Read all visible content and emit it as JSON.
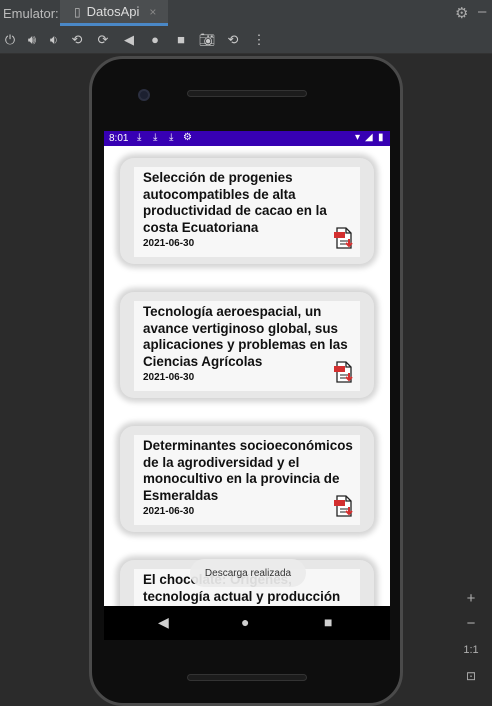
{
  "ide": {
    "emulator_label": "Emulator:",
    "tab_label": "DatosApi",
    "tab_close": "×"
  },
  "toolbar_icons": [
    "power-icon",
    "volume-up-icon",
    "volume-down-icon",
    "rotate-left-icon",
    "rotate-right-icon",
    "back-icon",
    "home-icon",
    "overview-icon",
    "camera-icon",
    "snapshot-icon",
    "more-icon"
  ],
  "status_bar": {
    "time": "8:01"
  },
  "articles": [
    {
      "title": "Selección de progenies autocompatibles de alta productividad de cacao en la costa Ecuatoriana",
      "date": "2021-06-30"
    },
    {
      "title": "Tecnología aeroespacial, un avance vertiginoso global, sus aplicaciones y problemas en las Ciencias Agrícolas",
      "date": "2021-06-30"
    },
    {
      "title": "Determinantes socioeconómicos de la agrodiversidad y el monocultivo en la provincia de Esmeraldas",
      "date": "2021-06-30"
    },
    {
      "title": "El chocolate: Orígenes, tecnología actual y producción de",
      "date": ""
    }
  ],
  "toast": "Descarga realizada",
  "zoom_controls": {
    "plus": "+",
    "minus": "−",
    "one_to_one": "1:1"
  },
  "colors": {
    "status_bar": "#3700b3",
    "pdf_red": "#d32f2f"
  }
}
